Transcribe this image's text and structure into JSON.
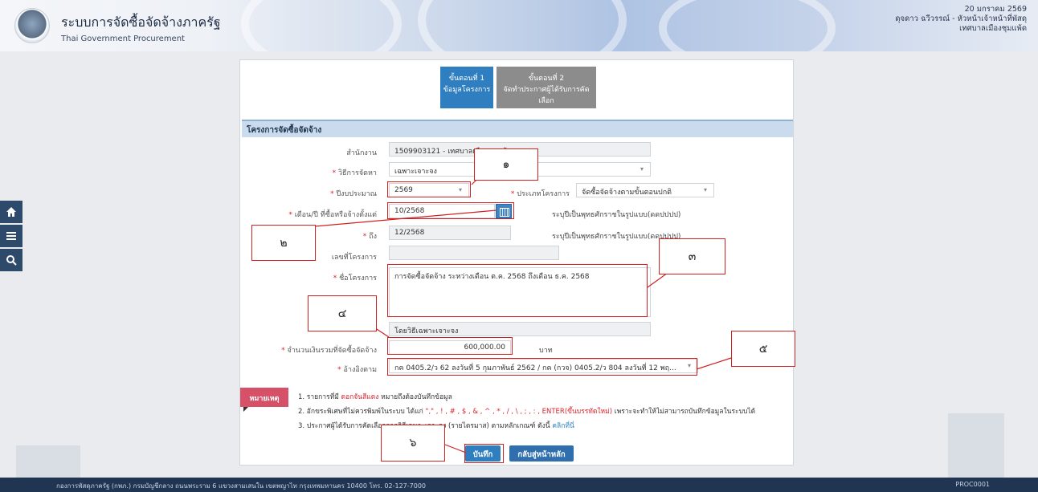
{
  "header": {
    "title_th": "ระบบการจัดซื้อจัดจ้างภาครัฐ",
    "title_en": "Thai Government Procurement",
    "date": "20 มกราคม 2569",
    "user": "ดุจดาว ฉวีวรรณ์ - หัวหน้าเจ้าหน้าที่พัสดุ",
    "org": "เทศบาลเมืองชุมแพ้ด"
  },
  "sidebar": {
    "items": [
      "home-icon",
      "menu-icon",
      "search-icon"
    ]
  },
  "steps": [
    {
      "line1": "ขั้นตอนที่ 1",
      "line2": "ข้อมูลโครงการ",
      "active": true,
      "color": "#2f7fc0"
    },
    {
      "line1": "ขั้นตอนที่ 2",
      "line2": "จัดทำประกาศผู้ได้รับการคัดเลือก",
      "active": false,
      "color": "#8c8c8c"
    }
  ],
  "section_title": "โครงการจัดซื้อจัดจ้าง",
  "form": {
    "agency": {
      "label": "สำนักงาน",
      "value": "1509903121 - เทศบาลเมืองชุมแพ้ด"
    },
    "method": {
      "label": "วิธีการจัดหา",
      "value": "เฉพาะเจาะจง"
    },
    "budget_year": {
      "label": "ปีงบประมาณ",
      "value": "2569"
    },
    "project_type": {
      "label": "ประเภทโครงการ",
      "value": "จัดซื้อจัดจ้างตามขั้นตอนปกติ"
    },
    "start_month": {
      "label": "เดือน/ปี ที่ซื้อหรือจ้างตั้งแต่",
      "value": "10/2568",
      "hint": "ระบุปีเป็นพุทธศักราชในรูปแบบ(ดดปปปป)"
    },
    "end_month": {
      "label": "ถึง",
      "value": "12/2568",
      "hint": "ระบุปีเป็นพุทธศักราชในรูปแบบ(ดดปปปป)"
    },
    "project_no": {
      "label": "เลขที่โครงการ",
      "value": ""
    },
    "project_name": {
      "label": "ชื่อโครงการ",
      "value": "การจัดซื้อจัดจ้าง ระหว่างเดือน ต.ค. 2568 ถึงเดือน ธ.ค. 2568"
    },
    "method_text": {
      "value": "โดยวิธีเฉพาะเจาะจง"
    },
    "amount": {
      "label": "จำนวนเงินรวมที่จัดซื้อจัดจ้าง",
      "value": "600,000.00",
      "unit": "บาท"
    },
    "reference": {
      "label": "อ้างอิงตาม",
      "value": "กค 0405.2/ว 62 ลงวันที่ 5 กุมภาพันธ์ 2562 / กค (กวจ) 0405.2/ว 804 ลงวันที่ 12 พฤ..."
    }
  },
  "notes": {
    "tag": "หมายเหตุ",
    "n1_a": "1. รายการที่มี",
    "n1_red": "ดอกจันสีแดง",
    "n1_b": "หมายถึงต้องบันทึกข้อมูล",
    "n2_a": "2. อักขระพิเศษที่ไม่ควรพิมพ์ในระบบ ได้แก่",
    "n2_red": "\",\" , ! , # , $ , & , ^ , * , / , \\ , ; , : , ENTER(ขึ้นบรรทัดใหม่)",
    "n2_b": "เพราะจะทำให้ไม่สามารถบันทึกข้อมูลในระบบได้",
    "n3_a": "3. ประกาศผู้ได้รับการคัดเลือกจากวิธีเฉพาะเจาะจง (รายไตรมาส) ตามหลักเกณฑ์ ดังนี้",
    "n3_link": "คลิกที่นี่"
  },
  "buttons": {
    "save": "บันทึก",
    "home": "กลับสู่หน้าหลัก"
  },
  "callouts": [
    "๑",
    "๒",
    "๓",
    "๔",
    "๕",
    "๖"
  ],
  "footer": {
    "text": "กองการพัสดุภาครัฐ (กพภ.) กรมบัญชีกลาง ถนนพระราม 6 แขวงสามเสนใน เขตพญาไท กรุงเทพมหานคร 10400 โทร. 02-127-7000",
    "code": "PROC0001"
  },
  "colors": {
    "primary": "#2f7fc0",
    "annotation": "#d32020",
    "note_tag": "#d65068",
    "footer": "#1f3552"
  }
}
